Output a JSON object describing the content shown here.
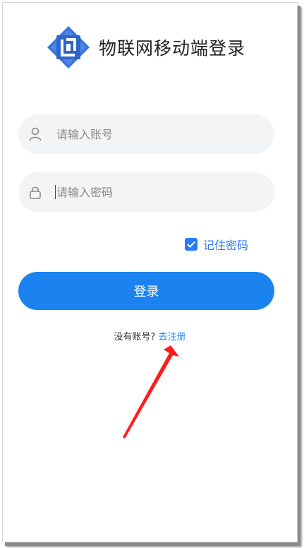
{
  "app": {
    "title": "物联网移动端登录",
    "logo_icon": "app-logo-icon",
    "brand_color": "#3b73d9"
  },
  "form": {
    "username_placeholder": "请输入账号",
    "password_placeholder": "请输入密码",
    "username_icon": "user-icon",
    "password_icon": "lock-icon",
    "remember_label": "记住密码",
    "remember_checked": true,
    "login_label": "登录"
  },
  "register": {
    "prompt": "没有账号?",
    "link": "去注册"
  },
  "annotation": {
    "arrow_color": "#ff1a1a"
  },
  "colors": {
    "primary": "#1a83f0",
    "field_bg": "#f3f4f6"
  }
}
